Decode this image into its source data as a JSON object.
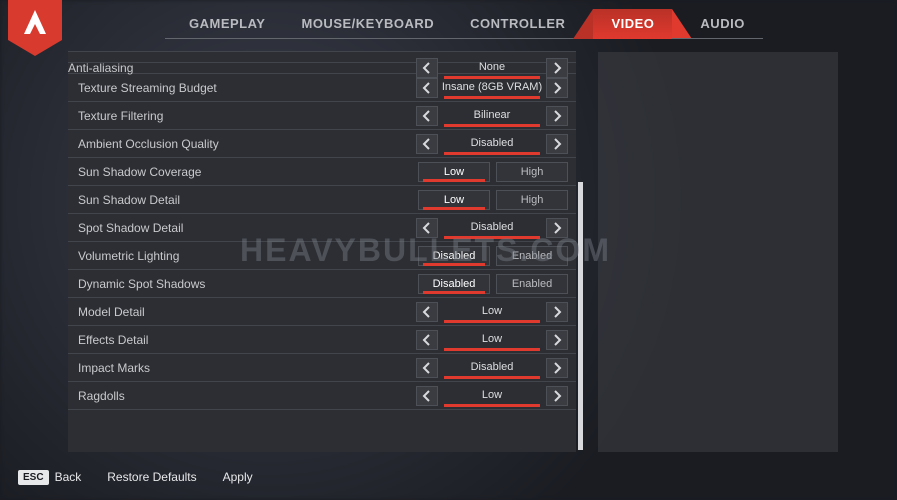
{
  "tabs": {
    "items": [
      {
        "label": "GAMEPLAY"
      },
      {
        "label": "MOUSE/KEYBOARD"
      },
      {
        "label": "CONTROLLER"
      },
      {
        "label": "VIDEO"
      },
      {
        "label": "AUDIO"
      }
    ],
    "activeIndex": 3
  },
  "settings": [
    {
      "label": "Anti-aliasing",
      "kind": "arrow",
      "value": "None"
    },
    {
      "label": "Texture Streaming Budget",
      "kind": "arrow",
      "value": "Insane (8GB VRAM)"
    },
    {
      "label": "Texture Filtering",
      "kind": "arrow",
      "value": "Bilinear"
    },
    {
      "label": "Ambient Occlusion Quality",
      "kind": "arrow",
      "value": "Disabled"
    },
    {
      "label": "Sun Shadow Coverage",
      "kind": "toggle",
      "opt1": "Low",
      "opt2": "High",
      "sel": 0
    },
    {
      "label": "Sun Shadow Detail",
      "kind": "toggle",
      "opt1": "Low",
      "opt2": "High",
      "sel": 0
    },
    {
      "label": "Spot Shadow Detail",
      "kind": "arrow",
      "value": "Disabled"
    },
    {
      "label": "Volumetric Lighting",
      "kind": "toggle",
      "opt1": "Disabled",
      "opt2": "Enabled",
      "sel": 0
    },
    {
      "label": "Dynamic Spot Shadows",
      "kind": "toggle",
      "opt1": "Disabled",
      "opt2": "Enabled",
      "sel": 0
    },
    {
      "label": "Model Detail",
      "kind": "arrow",
      "value": "Low"
    },
    {
      "label": "Effects Detail",
      "kind": "arrow",
      "value": "Low"
    },
    {
      "label": "Impact Marks",
      "kind": "arrow",
      "value": "Disabled"
    },
    {
      "label": "Ragdolls",
      "kind": "arrow",
      "value": "Low"
    }
  ],
  "footer": {
    "escKey": "ESC",
    "back": "Back",
    "restore": "Restore Defaults",
    "apply": "Apply"
  },
  "watermark": "HEAVYBULLETS.COM",
  "colors": {
    "accent": "#e0392e"
  }
}
